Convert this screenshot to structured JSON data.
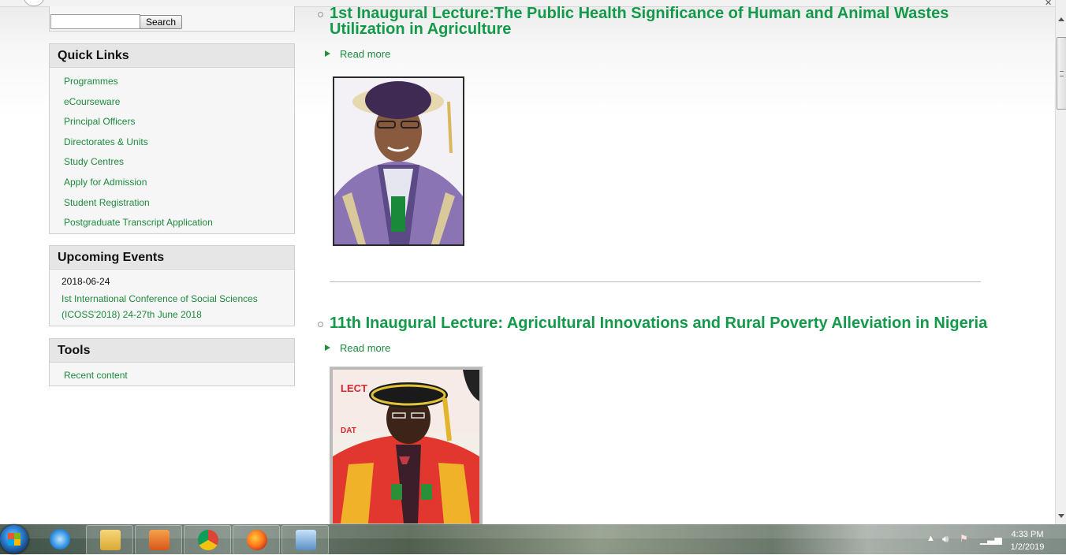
{
  "search": {
    "button_label": "Search",
    "value": ""
  },
  "quick_links": {
    "title": "Quick Links",
    "items": [
      "Programmes",
      "eCourseware",
      "Principal Officers",
      "Directorates & Units",
      "Study Centres",
      "Apply for Admission",
      "Student Registration",
      "Postgraduate Transcript Application"
    ]
  },
  "upcoming_events": {
    "title": "Upcoming Events",
    "date": "2018-06-24",
    "event": "Ist International Conference of Social Sciences (ICOSS'2018) 24-27th June 2018"
  },
  "tools": {
    "title": "Tools",
    "items": [
      "Recent content"
    ]
  },
  "articles": [
    {
      "title": "1st Inaugural Lecture:The Public Health Significance of Human and Animal Wastes Utilization in Agriculture",
      "read_more": "Read more"
    },
    {
      "title": "11th Inaugural Lecture: Agricultural Innovations and Rural Poverty Alleviation in Nigeria",
      "read_more": "Read more"
    }
  ],
  "photo2_text": "LECT",
  "photo2_text2": "DAT",
  "taskbar": {
    "apps": [
      "internet-explorer-icon",
      "file-explorer-icon",
      "media-player-icon",
      "chrome-icon",
      "firefox-icon",
      "network-app-icon"
    ],
    "time": "4:33 PM",
    "date": "1/2/2019"
  },
  "colors": {
    "link_green": "#1c8a3c",
    "title_green": "#13994a"
  }
}
